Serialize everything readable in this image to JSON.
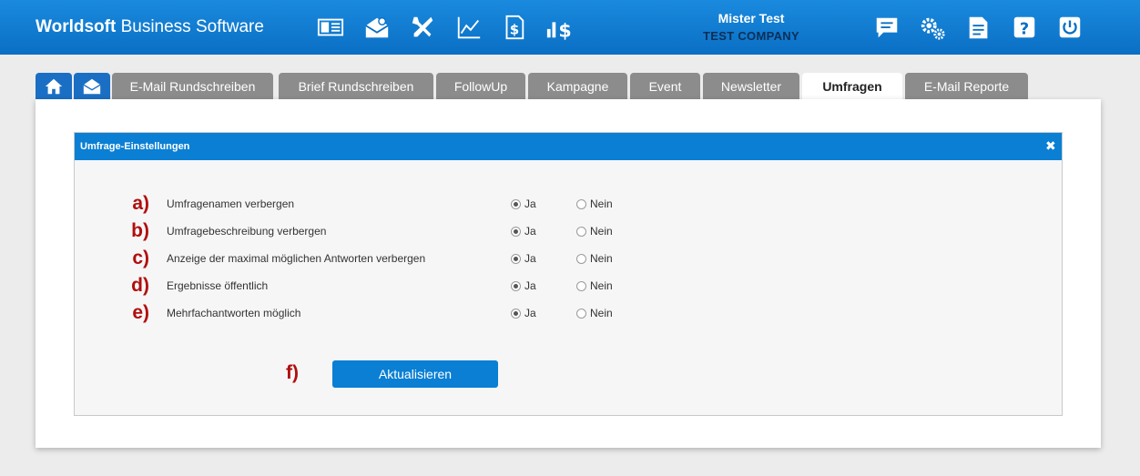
{
  "header": {
    "brand_bold": "Worldsoft",
    "brand_rest": " Business Software",
    "user_name": "Mister Test",
    "company": "TEST COMPANY",
    "left_icons": [
      "contact-card-icon",
      "mail-settings-icon",
      "tools-icon",
      "chart-line-icon",
      "invoice-dollar-icon",
      "sales-stats-icon"
    ],
    "right_icons": [
      "chat-icon",
      "gears-icon",
      "document-icon",
      "help-icon",
      "power-icon"
    ]
  },
  "tabs": [
    {
      "label": "",
      "icon": "home-icon"
    },
    {
      "label": "",
      "icon": "mail-icon"
    },
    {
      "label": "E-Mail Rundschreiben"
    },
    {
      "label": "Brief Rundschreiben"
    },
    {
      "label": "FollowUp"
    },
    {
      "label": "Kampagne"
    },
    {
      "label": "Event"
    },
    {
      "label": "Newsletter"
    },
    {
      "label": "Umfragen",
      "active": true
    },
    {
      "label": "E-Mail Reporte"
    }
  ],
  "panel": {
    "title": "Umfrage-Einstellungen",
    "close": "✖",
    "rows": [
      {
        "letter": "a)",
        "label": "Umfragenamen verbergen",
        "yes": "Ja",
        "no": "Nein",
        "selected": "yes"
      },
      {
        "letter": "b)",
        "label": "Umfragebeschreibung verbergen",
        "yes": "Ja",
        "no": "Nein",
        "selected": "yes"
      },
      {
        "letter": "c)",
        "label": "Anzeige der maximal möglichen Antworten verbergen",
        "yes": "Ja",
        "no": "Nein",
        "selected": "yes"
      },
      {
        "letter": "d)",
        "label": "Ergebnisse öffentlich",
        "yes": "Ja",
        "no": "Nein",
        "selected": "yes"
      },
      {
        "letter": "e)",
        "label": "Mehrfachantworten möglich",
        "yes": "Ja",
        "no": "Nein",
        "selected": "yes"
      }
    ],
    "submit_letter": "f)",
    "submit_label": "Aktualisieren"
  },
  "colors": {
    "header_blue": "#0a7fd4",
    "accent_red": "#b10e0e",
    "tab_gray": "#8c8c8c"
  }
}
